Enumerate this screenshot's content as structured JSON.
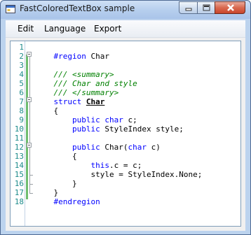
{
  "window": {
    "title": "FastColoredTextBox sample",
    "controls": [
      "minimize",
      "maximize",
      "close"
    ]
  },
  "menu": {
    "items": [
      "Edit",
      "Language",
      "Export"
    ]
  },
  "editor": {
    "line_numbers": [
      "1",
      "2",
      "3",
      "4",
      "5",
      "6",
      "7",
      "8",
      "9",
      "10",
      "11",
      "12",
      "13",
      "14",
      "15",
      "16",
      "17",
      "18"
    ],
    "lines": [
      [],
      [
        {
          "t": "    #region ",
          "c": "kw"
        },
        {
          "t": "Char",
          "c": ""
        }
      ],
      [],
      [
        {
          "t": "    /// <summary>",
          "c": "cm"
        }
      ],
      [
        {
          "t": "    /// Char and style",
          "c": "cm"
        }
      ],
      [
        {
          "t": "    /// </summary>",
          "c": "cm"
        }
      ],
      [
        {
          "t": "    struct ",
          "c": "kw"
        },
        {
          "t": "Char",
          "c": "bold"
        }
      ],
      [
        {
          "t": "    {",
          "c": ""
        }
      ],
      [
        {
          "t": "        ",
          "c": ""
        },
        {
          "t": "public ",
          "c": "kw"
        },
        {
          "t": "char ",
          "c": "kw"
        },
        {
          "t": "c;",
          "c": ""
        }
      ],
      [
        {
          "t": "        ",
          "c": ""
        },
        {
          "t": "public ",
          "c": "kw"
        },
        {
          "t": "StyleIndex style;",
          "c": ""
        }
      ],
      [],
      [
        {
          "t": "        ",
          "c": ""
        },
        {
          "t": "public ",
          "c": "kw"
        },
        {
          "t": "Char(",
          "c": ""
        },
        {
          "t": "char ",
          "c": "kw"
        },
        {
          "t": "c)",
          "c": ""
        }
      ],
      [
        {
          "t": "        {",
          "c": ""
        }
      ],
      [
        {
          "t": "            ",
          "c": ""
        },
        {
          "t": "this",
          "c": "kw"
        },
        {
          "t": ".c = c;",
          "c": ""
        }
      ],
      [
        {
          "t": "            style = StyleIndex.None;",
          "c": ""
        }
      ],
      [
        {
          "t": "        }",
          "c": ""
        }
      ],
      [
        {
          "t": "    }",
          "c": ""
        }
      ],
      [
        {
          "t": "    #endregion",
          "c": "kw"
        }
      ]
    ]
  },
  "colors": {
    "keyword": "#0000ff",
    "comment": "#008000",
    "line_number": "#1e8c8c",
    "changed_line_marker": "#6ebd6e"
  }
}
